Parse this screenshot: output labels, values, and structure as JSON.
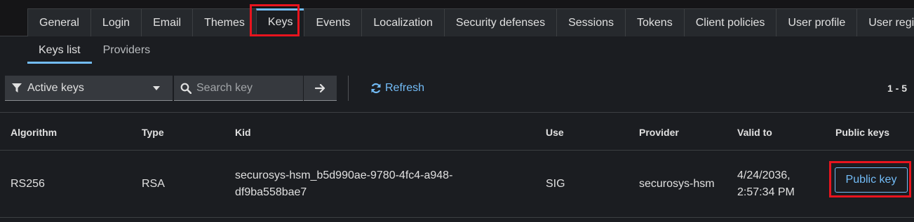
{
  "tabs": [
    {
      "label": "General"
    },
    {
      "label": "Login"
    },
    {
      "label": "Email"
    },
    {
      "label": "Themes"
    },
    {
      "label": "Keys",
      "active": true
    },
    {
      "label": "Events"
    },
    {
      "label": "Localization"
    },
    {
      "label": "Security defenses"
    },
    {
      "label": "Sessions"
    },
    {
      "label": "Tokens"
    },
    {
      "label": "Client policies"
    },
    {
      "label": "User profile"
    },
    {
      "label": "User registr"
    }
  ],
  "subtabs": [
    {
      "label": "Keys list",
      "active": true
    },
    {
      "label": "Providers"
    }
  ],
  "toolbar": {
    "filter_value": "Active keys",
    "search_placeholder": "Search key",
    "refresh_label": "Refresh",
    "pagination": "1 - 5"
  },
  "table": {
    "headers": [
      "Algorithm",
      "Type",
      "Kid",
      "Use",
      "Provider",
      "Valid to",
      "Public keys"
    ],
    "rows": [
      {
        "algorithm": "RS256",
        "type": "RSA",
        "kid": "securosys-hsm_b5d990ae-9780-4fc4-a948-df9ba558bae7",
        "use": "SIG",
        "provider": "securosys-hsm",
        "valid_to": "4/24/2036, 2:57:34 PM",
        "public_key_label": "Public key"
      }
    ]
  },
  "colors": {
    "accent": "#73bcf7",
    "highlight": "#e8141e",
    "background": "#1b1d21"
  },
  "icons": [
    "filter-icon",
    "caret-down-icon",
    "search-icon",
    "arrow-right-icon",
    "refresh-icon"
  ]
}
